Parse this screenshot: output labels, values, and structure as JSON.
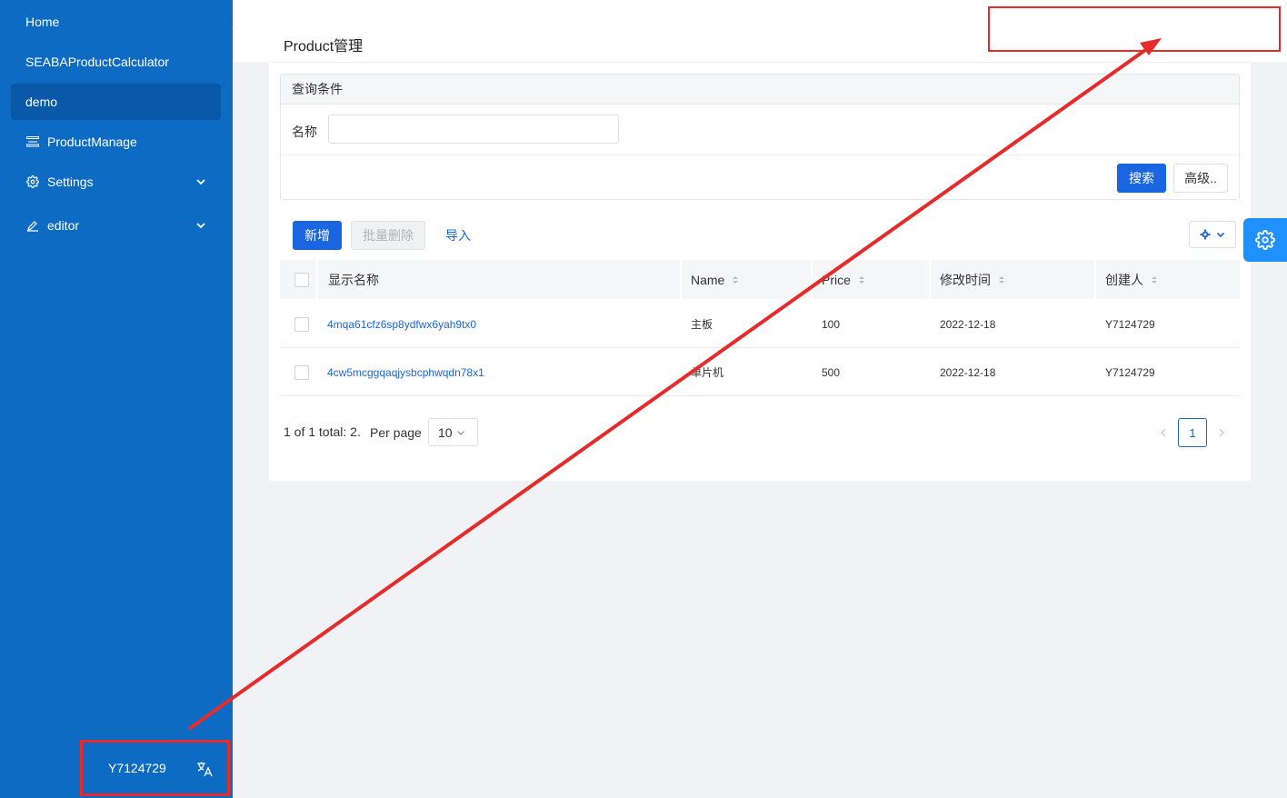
{
  "sidebar": {
    "items": [
      {
        "label": "Home"
      },
      {
        "label": "SEABAProductCalculator"
      },
      {
        "label": "demo"
      },
      {
        "label": "ProductManage"
      },
      {
        "label": "Settings"
      },
      {
        "label": "editor"
      }
    ],
    "user": "Y7124729"
  },
  "header": {
    "title": "Product管理"
  },
  "query": {
    "header": "查询条件",
    "name_label": "名称",
    "name_value": "",
    "search_label": "搜索",
    "advanced_label": "高级.."
  },
  "toolbar": {
    "add_label": "新增",
    "batch_delete_label": "批量删除",
    "import_label": "导入"
  },
  "table": {
    "columns": [
      "显示名称",
      "Name",
      "Price",
      "修改时间",
      "创建人"
    ],
    "rows": [
      {
        "display_name": "4mqa61cfz6sp8ydfwx6yah9tx0",
        "name": "主板",
        "price": "100",
        "modified": "2022-12-18",
        "creator": "Y7124729"
      },
      {
        "display_name": "4cw5mcggqaqjysbcphwqdn78x1",
        "name": "单片机",
        "price": "500",
        "modified": "2022-12-18",
        "creator": "Y7124729"
      }
    ]
  },
  "pagination": {
    "summary": "1 of 1 total: 2.",
    "per_page_label": "Per page",
    "per_page_value": "10",
    "current_page": "1"
  },
  "colors": {
    "sidebar": "#0e6bc4",
    "primary": "#1a66e0",
    "annotation": "#e62b2b"
  }
}
